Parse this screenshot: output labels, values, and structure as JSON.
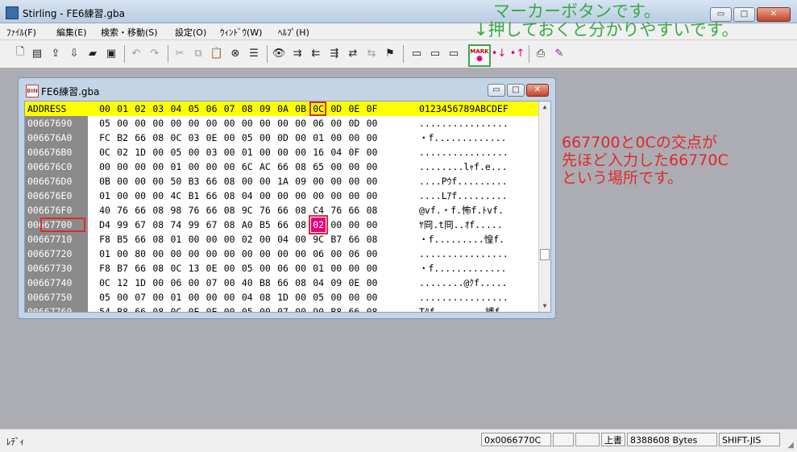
{
  "window": {
    "title": "Stirling - FE6練習.gba",
    "min": "▭",
    "max": "□",
    "close": "✕"
  },
  "menu": [
    "ﾌｧｲﾙ(F)",
    "編集(E)",
    "検索・移動(S)",
    "設定(O)",
    "ｳｨﾝﾄﾞｳ(W)",
    "ﾍﾙﾌﾟ(H)"
  ],
  "toolbar_icons": [
    "new-file-icon",
    "insert-file-icon",
    "export-icon",
    "import-icon",
    "open-folder-icon",
    "save-icon",
    "undo-icon",
    "redo-icon",
    "cut-icon",
    "copy-icon",
    "paste-icon",
    "delete-icon",
    "list-icon",
    "find-icon",
    "find-next-icon",
    "find-prev-icon",
    "find-all-icon",
    "replace-icon",
    "replace-all-icon",
    "goto-icon",
    "bookmark-up-icon",
    "bookmark-down-icon",
    "bookmark-clear-icon",
    "marker-icon",
    "marker-next-icon",
    "marker-prev-icon",
    "print-icon",
    "help-icon"
  ],
  "marker_label": "MARK",
  "child": {
    "title": "FE6練習.gba",
    "header": {
      "address": "ADDRESS",
      "columns": [
        "00",
        "01",
        "02",
        "03",
        "04",
        "05",
        "06",
        "07",
        "08",
        "09",
        "0A",
        "0B",
        "0C",
        "0D",
        "0E",
        "0F"
      ],
      "ascii": "0123456789ABCDEF"
    },
    "rows": [
      {
        "addr": "00667690",
        "bytes": [
          "05",
          "00",
          "00",
          "00",
          "00",
          "00",
          "00",
          "00",
          "00",
          "00",
          "00",
          "00",
          "06",
          "00",
          "0D",
          "00"
        ],
        "ascii": "................"
      },
      {
        "addr": "006676A0",
        "bytes": [
          "FC",
          "B2",
          "66",
          "08",
          "0C",
          "03",
          "0E",
          "00",
          "05",
          "00",
          "0D",
          "00",
          "01",
          "00",
          "00",
          "00"
        ],
        "ascii": "・f............."
      },
      {
        "addr": "006676B0",
        "bytes": [
          "0C",
          "02",
          "1D",
          "00",
          "05",
          "00",
          "03",
          "00",
          "01",
          "00",
          "00",
          "00",
          "16",
          "04",
          "0F",
          "00"
        ],
        "ascii": "................"
      },
      {
        "addr": "006676C0",
        "bytes": [
          "00",
          "00",
          "00",
          "00",
          "01",
          "00",
          "00",
          "00",
          "6C",
          "AC",
          "66",
          "08",
          "65",
          "00",
          "00",
          "00"
        ],
        "ascii": "........lｬf.e..."
      },
      {
        "addr": "006676D0",
        "bytes": [
          "0B",
          "00",
          "00",
          "00",
          "50",
          "B3",
          "66",
          "08",
          "00",
          "00",
          "1A",
          "09",
          "00",
          "00",
          "00",
          "00"
        ],
        "ascii": "....Pｳf........."
      },
      {
        "addr": "006676E0",
        "bytes": [
          "01",
          "00",
          "00",
          "00",
          "4C",
          "B1",
          "66",
          "08",
          "04",
          "00",
          "00",
          "00",
          "00",
          "00",
          "00",
          "00"
        ],
        "ascii": "....Lｱf........."
      },
      {
        "addr": "006676F0",
        "bytes": [
          "40",
          "76",
          "66",
          "08",
          "98",
          "76",
          "66",
          "08",
          "9C",
          "76",
          "66",
          "08",
          "C4",
          "76",
          "66",
          "08"
        ],
        "ascii": "@vf.・f.怖f.ﾄvf."
      },
      {
        "addr": "00667700",
        "bytes": [
          "D4",
          "99",
          "67",
          "08",
          "74",
          "99",
          "67",
          "08",
          "A0",
          "B5",
          "66",
          "08",
          "02",
          "00",
          "00",
          "00"
        ],
        "ascii": "ﾔ冏.t冏..ｵf....."
      },
      {
        "addr": "00667710",
        "bytes": [
          "F8",
          "B5",
          "66",
          "08",
          "01",
          "00",
          "00",
          "00",
          "02",
          "00",
          "04",
          "00",
          "9C",
          "B7",
          "66",
          "08"
        ],
        "ascii": "・f.........惶f."
      },
      {
        "addr": "00667720",
        "bytes": [
          "01",
          "00",
          "80",
          "00",
          "00",
          "00",
          "00",
          "00",
          "00",
          "00",
          "00",
          "00",
          "06",
          "00",
          "06",
          "00"
        ],
        "ascii": "................"
      },
      {
        "addr": "00667730",
        "bytes": [
          "F8",
          "B7",
          "66",
          "08",
          "0C",
          "13",
          "0E",
          "00",
          "05",
          "00",
          "06",
          "00",
          "01",
          "00",
          "00",
          "00"
        ],
        "ascii": "・f............."
      },
      {
        "addr": "00667740",
        "bytes": [
          "0C",
          "12",
          "1D",
          "00",
          "06",
          "00",
          "07",
          "00",
          "40",
          "B8",
          "66",
          "08",
          "04",
          "09",
          "0E",
          "00"
        ],
        "ascii": "........@ｸf....."
      },
      {
        "addr": "00667750",
        "bytes": [
          "05",
          "00",
          "07",
          "00",
          "01",
          "00",
          "00",
          "00",
          "04",
          "08",
          "1D",
          "00",
          "05",
          "00",
          "00",
          "00"
        ],
        "ascii": "................"
      },
      {
        "addr": "00667760",
        "bytes": [
          "54",
          "B8",
          "66",
          "08",
          "0C",
          "0E",
          "0E",
          "00",
          "05",
          "00",
          "07",
          "00",
          "90",
          "B8",
          "66",
          "08"
        ],
        "ascii": "Tｸf.........搏f."
      }
    ]
  },
  "annotations": {
    "marker_line1": "マーカーボタンです。",
    "marker_line2": "↓押しておくと分かりやすいです。",
    "explain": [
      "667700と0Cの交点が",
      "先ほど入力した66770C",
      "という場所です。"
    ]
  },
  "status": {
    "ready": "ﾚﾃﾞｨ",
    "address": "0x0066770C",
    "mode": "上書",
    "size": "8388608 Bytes",
    "encoding": "SHIFT-JIS"
  },
  "colors": {
    "header_highlight": "#ffff00",
    "selection": "#e4007f",
    "annotation_red": "#e0282e",
    "annotation_green": "#3aa845",
    "address_column": "#8a8a8a"
  }
}
